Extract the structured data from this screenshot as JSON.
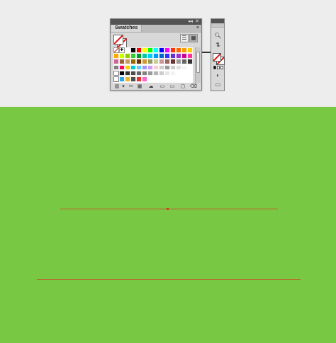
{
  "swatches_panel": {
    "title_controls": [
      "◂◂",
      "✕"
    ],
    "tab_label": "Swatches",
    "menu_icon": "≡",
    "view_buttons": [
      "list-view-icon",
      "grid-view-icon"
    ],
    "swatch_rows": [
      [
        "none",
        "registration",
        "#ffffff",
        "#000000",
        "#ff0000",
        "#ffff00",
        "#00ff00",
        "#00ffff",
        "#0000ff",
        "#ff00ff",
        "#ff3300",
        "#ff6600",
        "#ff9900",
        "#ffcc00"
      ],
      [
        "#ffaa00",
        "#ccff00",
        "#99cc00",
        "#33cc33",
        "#009933",
        "#00cc99",
        "#00ccff",
        "#0099ff",
        "#0066cc",
        "#3333ff",
        "#6633cc",
        "#9933cc",
        "#cc0099",
        "#ff3399"
      ],
      [
        "#cc6699",
        "#996633",
        "#cc9966",
        "#996600",
        "#663300",
        "#cc9933",
        "#999966",
        "#cccc99",
        "#cc9999",
        "#996666",
        "#663333",
        "#999999",
        "#666666",
        "#333333"
      ],
      [
        "#808080",
        "#ff0066",
        "#ffcc00",
        "#00cccc",
        "#66ccff",
        "#9999ff",
        "#cc99ff",
        "#ffcccc",
        "#cccccc",
        "#999999",
        "#cccccc",
        "#e0e0e0",
        "#f5f5f5",
        "#ffffff"
      ],
      [
        "folder",
        "#000000",
        "#333333",
        "#4d4d4d",
        "#666666",
        "#808080",
        "#999999",
        "#b3b3b3",
        "#cccccc",
        "#e6e6e6",
        "#f2f2f2",
        "#ffffff",
        "#ffffff",
        "#ffffff"
      ],
      [
        "folder",
        "#2ea3e6",
        "#e6b82e",
        "#4d4d4d",
        "#e6332e",
        "#ff66cc",
        "#ffffff",
        "#ffffff",
        "#ffffff",
        "#ffffff",
        "#ffffff",
        "#ffffff",
        "#ffffff",
        "#ffffff"
      ]
    ],
    "bottom_icons": [
      "library-icon",
      "swatch-kinds-icon",
      "show-options-icon",
      "swatch-group-icon",
      "cloud-icon",
      "new-group-icon",
      "new-swatch-icon",
      "delete-icon"
    ]
  },
  "tools_panel": {
    "icons": [
      "zoom-icon",
      "swap-icon",
      "default-colors-icon",
      "fill-stroke-icon",
      "color-mode-icon",
      "drawing-mode-icon",
      "screen-mode-icon"
    ]
  },
  "canvas": {
    "background": "#79c843",
    "path_color": "#c8542a"
  }
}
